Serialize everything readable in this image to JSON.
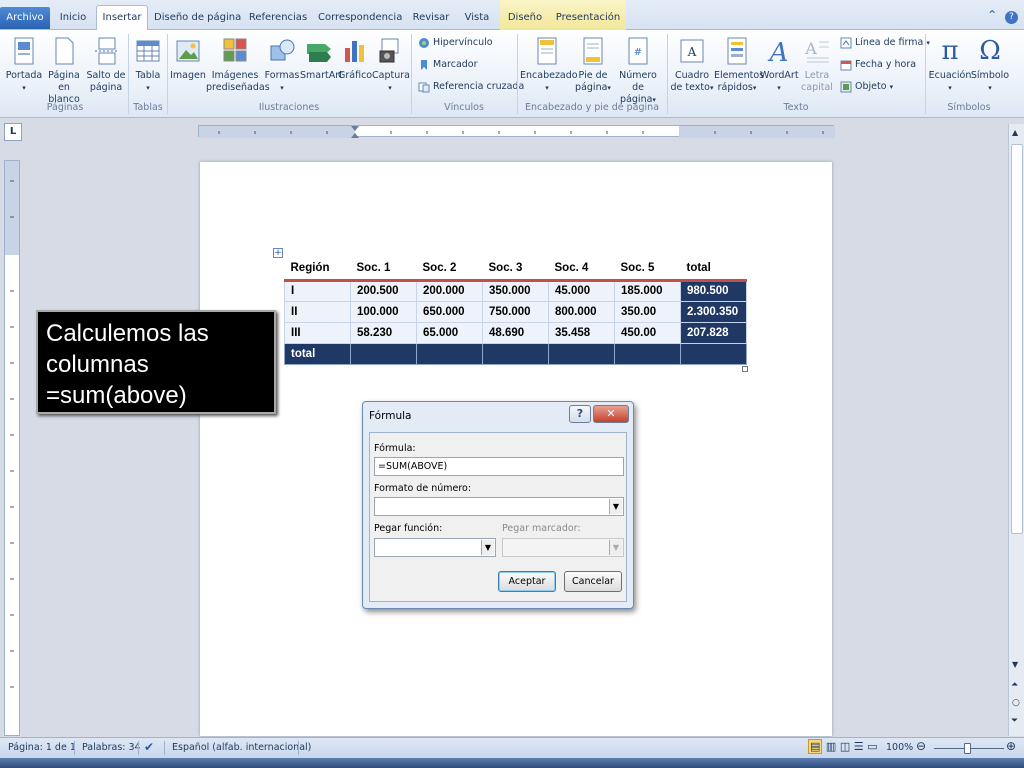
{
  "tabs": [
    "Archivo",
    "Inicio",
    "Insertar",
    "Diseño de página",
    "Referencias",
    "Correspondencia",
    "Revisar",
    "Vista",
    "Diseño",
    "Presentación"
  ],
  "ribbon": {
    "pages": {
      "portada": "Portada",
      "pagina_blanco": "Página\nen blanco",
      "salto": "Salto de\npágina",
      "group": "Páginas"
    },
    "tables": {
      "tabla": "Tabla",
      "group": "Tablas"
    },
    "illustrations": {
      "imagen": "Imagen",
      "imagenes": "Imágenes\nprediseñadas",
      "formas": "Formas",
      "smartart": "SmartArt",
      "grafico": "Gráfico",
      "captura": "Captura",
      "group": "Ilustraciones"
    },
    "links": {
      "hipervinculo": "Hipervínculo",
      "marcador": "Marcador",
      "referencia": "Referencia cruzada",
      "group": "Vínculos"
    },
    "header_footer": {
      "encabezado": "Encabezado",
      "pie": "Pie de\npágina",
      "numero": "Número de\npágina",
      "group": "Encabezado y pie de página"
    },
    "text": {
      "cuadro": "Cuadro\nde texto",
      "elementos": "Elementos\nrápidos",
      "wordart": "WordArt",
      "letra": "Letra\ncapital",
      "linea_firma": "Línea de firma",
      "fecha": "Fecha y hora",
      "objeto": "Objeto",
      "group": "Texto"
    },
    "symbols": {
      "ecuacion": "Ecuación",
      "simbolo": "Símbolo",
      "group": "Símbolos"
    }
  },
  "ruler_marker": "L",
  "table": {
    "headers": [
      "Región",
      "Soc. 1",
      "Soc. 2",
      "Soc. 3",
      "Soc. 4",
      "Soc. 5",
      "total"
    ],
    "rows": [
      [
        "I",
        "200.500",
        "200.000",
        "350.000",
        "45.000",
        "185.000",
        "980.500"
      ],
      [
        "II",
        "100.000",
        "650.000",
        "750.000",
        "800.000",
        "350.00",
        "2.300.350"
      ],
      [
        "III",
        "58.230",
        "65.000",
        "48.690",
        "35.458",
        "450.00",
        "207.828"
      ]
    ],
    "total_label": "total"
  },
  "callout": {
    "line1": "Calculemos las",
    "line2": "columnas",
    "line3": "=sum(above)"
  },
  "dialog": {
    "title": "Fórmula",
    "formula_label": "Fórmula:",
    "formula_value": "=SUM(ABOVE)",
    "format_label": "Formato de número:",
    "function_label": "Pegar función:",
    "bookmark_label": "Pegar marcador:",
    "ok": "Aceptar",
    "cancel": "Cancelar",
    "help": "?",
    "close": "✕"
  },
  "status": {
    "page": "Página: 1 de 1",
    "words": "Palabras: 34",
    "language": "Español (alfab. internacional)",
    "zoom": "100%"
  },
  "colors": {
    "accent_blue": "#203864",
    "header_rule": "#c0504d",
    "file_tab": "#2a62b3"
  }
}
